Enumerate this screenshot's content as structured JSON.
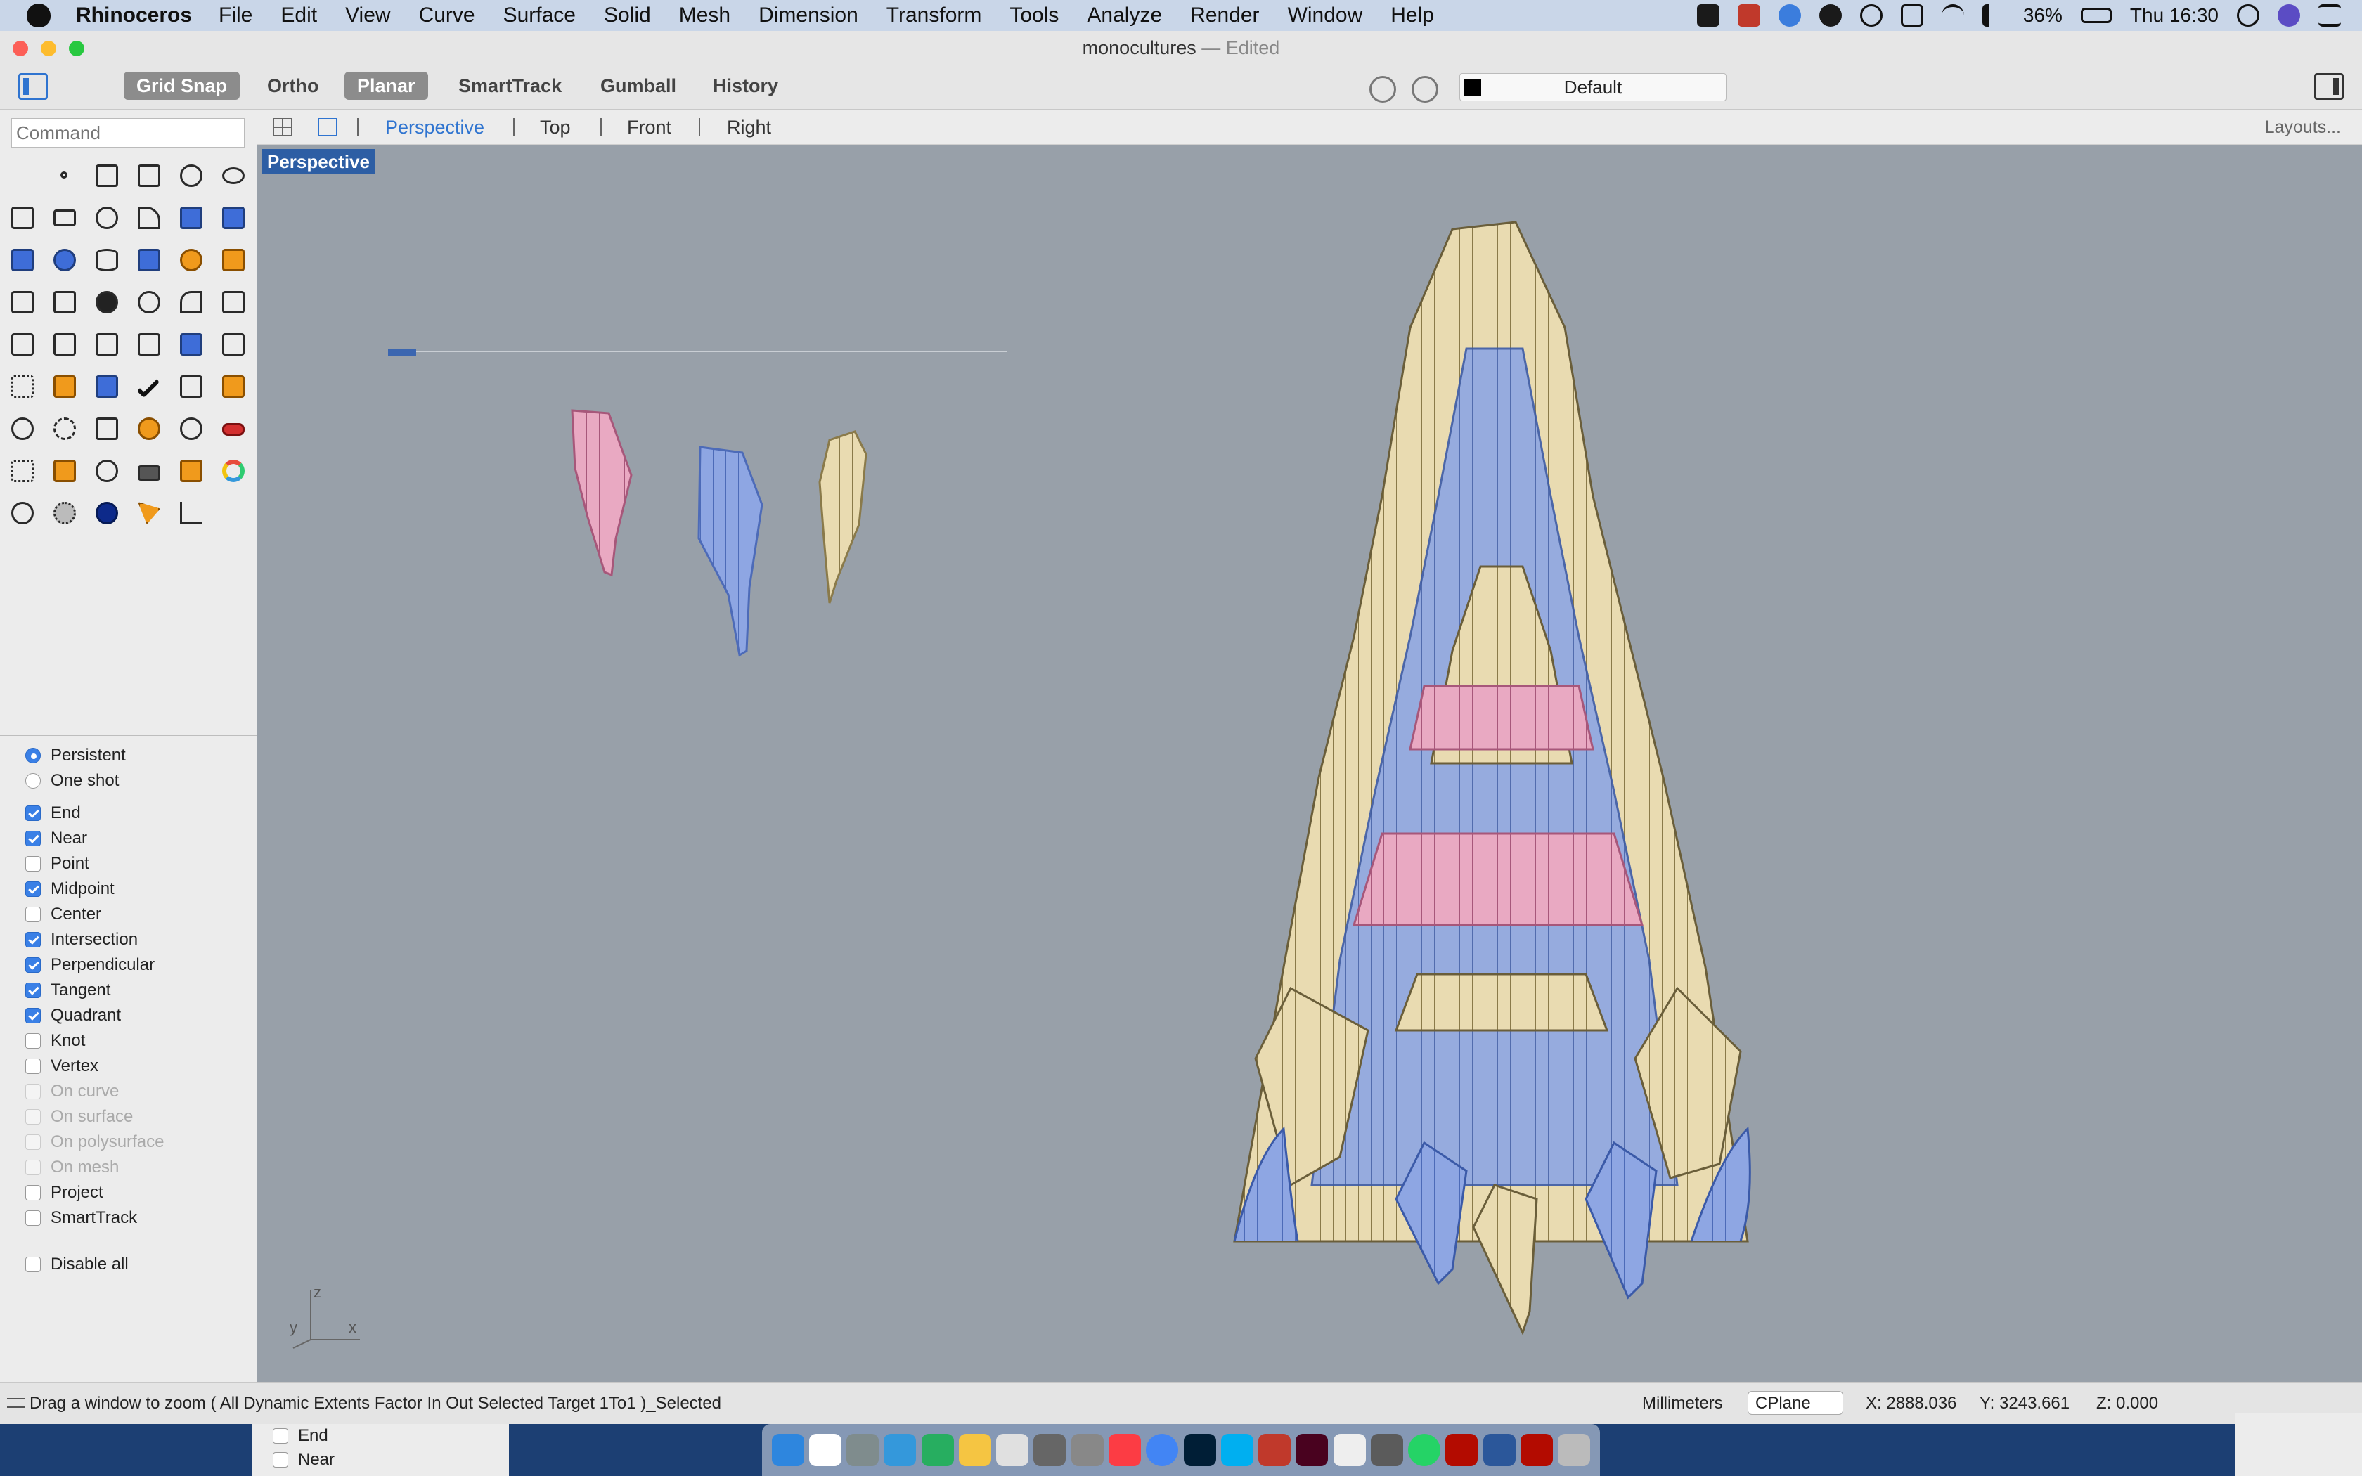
{
  "menubar": {
    "app_name": "Rhinoceros",
    "items": [
      "File",
      "Edit",
      "View",
      "Curve",
      "Surface",
      "Solid",
      "Mesh",
      "Dimension",
      "Transform",
      "Tools",
      "Analyze",
      "Render",
      "Window",
      "Help"
    ],
    "battery": "36%",
    "clock": "Thu 16:30"
  },
  "window": {
    "doc_title": "monocultures",
    "doc_state": "— Edited"
  },
  "toolbar": {
    "grid_snap": "Grid Snap",
    "ortho": "Ortho",
    "planar": "Planar",
    "smarttrack": "SmartTrack",
    "gumball": "Gumball",
    "history": "History",
    "layer": "Default",
    "layer_color": "#000000"
  },
  "command": {
    "placeholder": "Command"
  },
  "viewtabs": {
    "tabs": [
      "Perspective",
      "Top",
      "Front",
      "Right"
    ],
    "active": "Perspective",
    "layouts": "Layouts..."
  },
  "viewport": {
    "label": "Perspective",
    "axis_x": "x",
    "axis_y": "y",
    "axis_z": "z",
    "colors": {
      "blue": "#8ea6e3",
      "yellow": "#e9dbb1",
      "pink": "#e9a9c2",
      "background": "#98a0a9"
    }
  },
  "osnap": {
    "modes": [
      {
        "label": "Persistent",
        "type": "radio",
        "checked": true
      },
      {
        "label": "One shot",
        "type": "radio",
        "checked": false
      }
    ],
    "items": [
      {
        "label": "End",
        "checked": true,
        "disabled": false
      },
      {
        "label": "Near",
        "checked": true,
        "disabled": false
      },
      {
        "label": "Point",
        "checked": false,
        "disabled": false
      },
      {
        "label": "Midpoint",
        "checked": true,
        "disabled": false
      },
      {
        "label": "Center",
        "checked": false,
        "disabled": false
      },
      {
        "label": "Intersection",
        "checked": true,
        "disabled": false
      },
      {
        "label": "Perpendicular",
        "checked": true,
        "disabled": false
      },
      {
        "label": "Tangent",
        "checked": true,
        "disabled": false
      },
      {
        "label": "Quadrant",
        "checked": true,
        "disabled": false
      },
      {
        "label": "Knot",
        "checked": false,
        "disabled": false
      },
      {
        "label": "Vertex",
        "checked": false,
        "disabled": false
      },
      {
        "label": "On curve",
        "checked": false,
        "disabled": true
      },
      {
        "label": "On surface",
        "checked": false,
        "disabled": true
      },
      {
        "label": "On polysurface",
        "checked": false,
        "disabled": true
      },
      {
        "label": "On mesh",
        "checked": false,
        "disabled": true
      },
      {
        "label": "Project",
        "checked": false,
        "disabled": false
      },
      {
        "label": "SmartTrack",
        "checked": false,
        "disabled": false
      }
    ],
    "disable_all": "Disable all"
  },
  "statusbar": {
    "message": "Drag a window to zoom ( All Dynamic Extents Factor In Out Selected Target 1To1 )_Selected",
    "units": "Millimeters",
    "cplane": "CPlane",
    "x": "X: 2888.036",
    "y": "Y: 3243.661",
    "z": "Z: 0.000"
  },
  "background_panel": {
    "items": [
      "End",
      "Near"
    ]
  }
}
